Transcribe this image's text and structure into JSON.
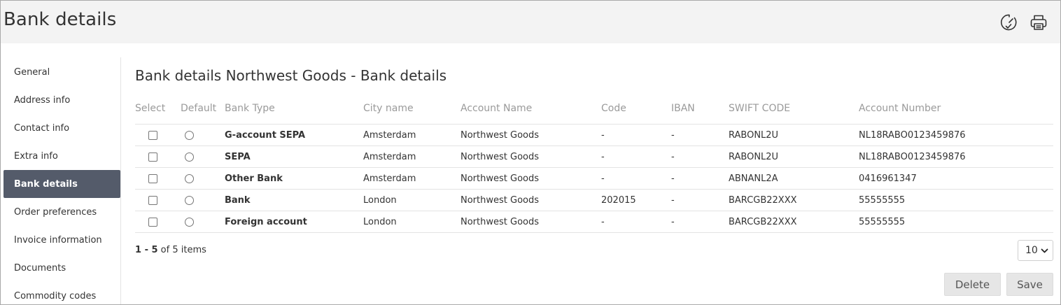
{
  "header": {
    "title": "Bank details",
    "icons": {
      "timer": "timer-check-icon",
      "print": "printer-icon"
    }
  },
  "sidebar": {
    "items": [
      {
        "label": "General",
        "active": false
      },
      {
        "label": "Address info",
        "active": false
      },
      {
        "label": "Contact info",
        "active": false
      },
      {
        "label": "Extra info",
        "active": false
      },
      {
        "label": "Bank details",
        "active": true
      },
      {
        "label": "Order preferences",
        "active": false
      },
      {
        "label": "Invoice information",
        "active": false
      },
      {
        "label": "Documents",
        "active": false
      },
      {
        "label": "Commodity codes",
        "active": false
      }
    ]
  },
  "main": {
    "section_title": "Bank details Northwest Goods - Bank details",
    "table": {
      "columns": [
        "Select",
        "Default",
        "Bank Type",
        "City name",
        "Account Name",
        "Code",
        "IBAN",
        "SWIFT CODE",
        "Account Number"
      ],
      "rows": [
        {
          "bank_type": "G-account SEPA",
          "city": "Amsterdam",
          "account_name": "Northwest Goods",
          "code": "-",
          "iban": "-",
          "swift": "RABONL2U",
          "account_number": "NL18RABO0123459876"
        },
        {
          "bank_type": "SEPA",
          "city": "Amsterdam",
          "account_name": "Northwest Goods",
          "code": "-",
          "iban": "-",
          "swift": "RABONL2U",
          "account_number": "NL18RABO0123459876"
        },
        {
          "bank_type": "Other Bank",
          "city": "Amsterdam",
          "account_name": "Northwest Goods",
          "code": "-",
          "iban": "-",
          "swift": "ABNANL2A",
          "account_number": "0416961347"
        },
        {
          "bank_type": "Bank",
          "city": "London",
          "account_name": "Northwest Goods",
          "code": "202015",
          "iban": "-",
          "swift": "BARCGB22XXX",
          "account_number": "55555555"
        },
        {
          "bank_type": "Foreign account",
          "city": "London",
          "account_name": "Northwest Goods",
          "code": "-",
          "iban": "-",
          "swift": "BARCGB22XXX",
          "account_number": "55555555"
        }
      ]
    },
    "pager": {
      "range": "1 - 5",
      "of_text": " of 5 items",
      "page_size": "10"
    },
    "buttons": {
      "delete": "Delete",
      "save": "Save"
    }
  },
  "colors": {
    "active_nav": "#545b6a",
    "header_bg": "#f3f3f3",
    "button_bg": "#e6e6e6"
  }
}
